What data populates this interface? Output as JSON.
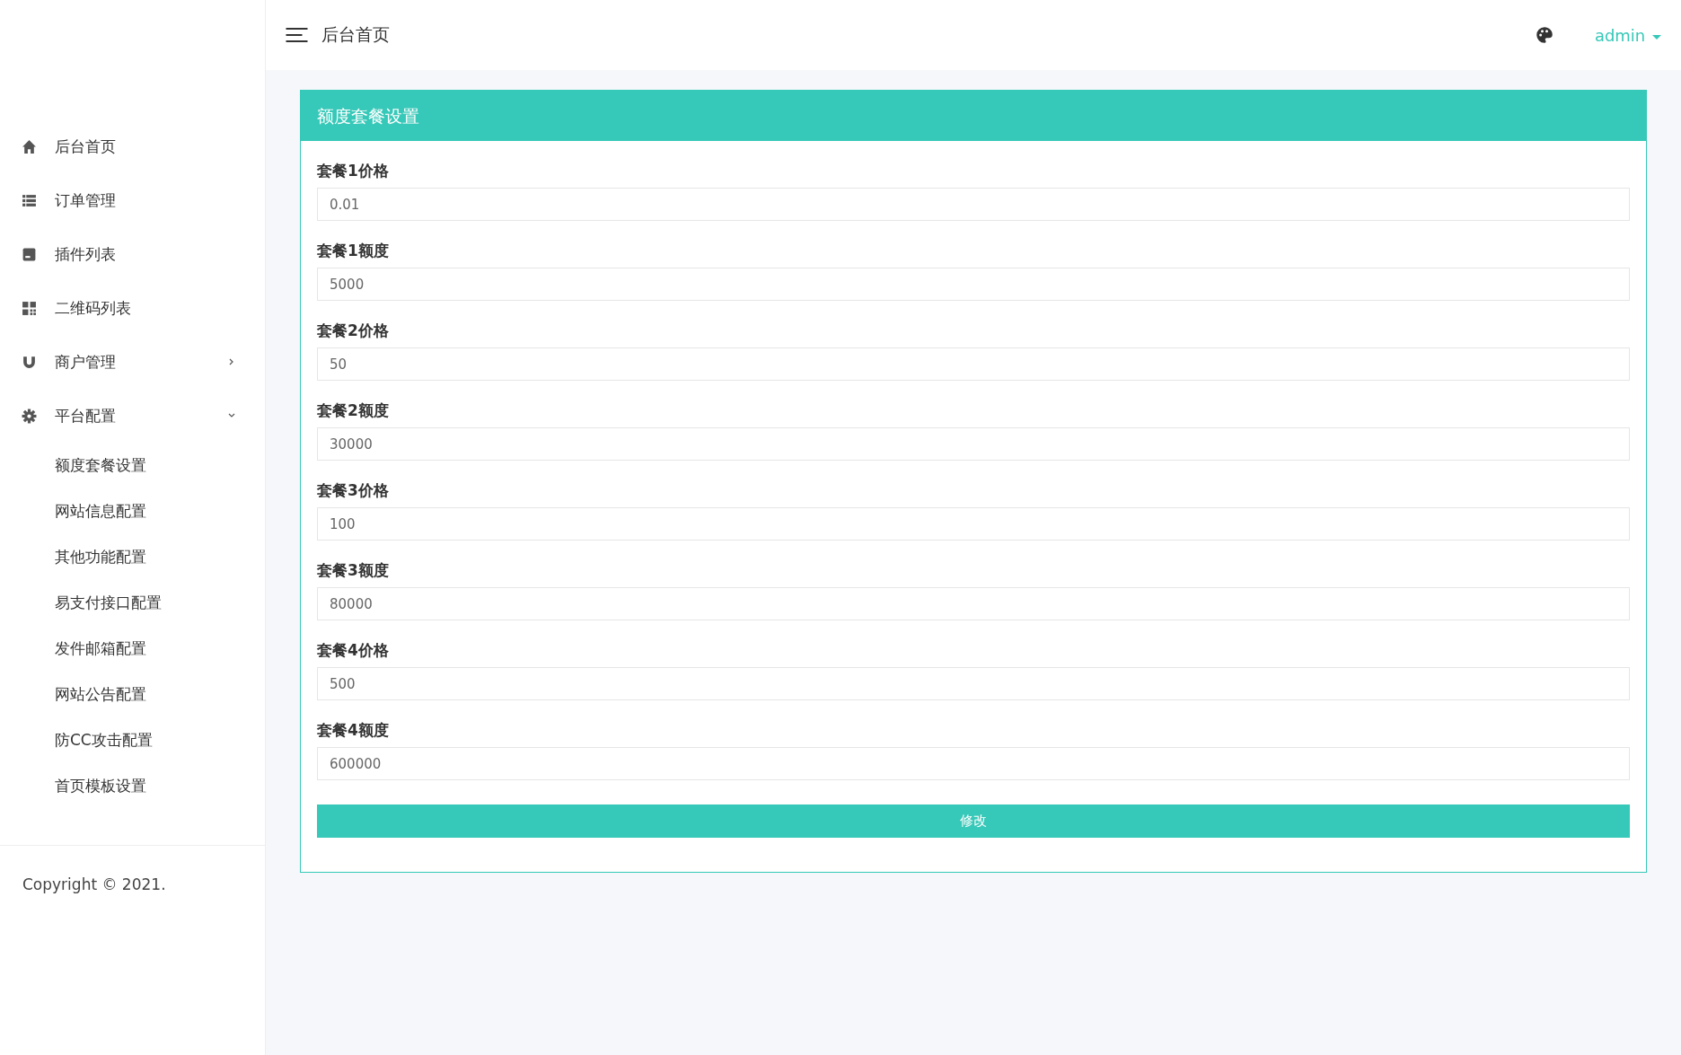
{
  "header": {
    "title": "后台首页",
    "user": "admin"
  },
  "sidebar": {
    "items": [
      {
        "label": "后台首页"
      },
      {
        "label": "订单管理"
      },
      {
        "label": "插件列表"
      },
      {
        "label": "二维码列表"
      },
      {
        "label": "商户管理",
        "expanded": false
      },
      {
        "label": "平台配置",
        "expanded": true,
        "children": [
          {
            "label": "额度套餐设置"
          },
          {
            "label": "网站信息配置"
          },
          {
            "label": "其他功能配置"
          },
          {
            "label": "易支付接口配置"
          },
          {
            "label": "发件邮箱配置"
          },
          {
            "label": "网站公告配置"
          },
          {
            "label": "防CC攻击配置"
          },
          {
            "label": "首页模板设置"
          }
        ]
      }
    ],
    "copyright": "Copyright © 2021."
  },
  "card": {
    "title": "额度套餐设置",
    "fields": [
      {
        "label": "套餐1价格",
        "value": "0.01"
      },
      {
        "label": "套餐1额度",
        "value": "5000"
      },
      {
        "label": "套餐2价格",
        "value": "50"
      },
      {
        "label": "套餐2额度",
        "value": "30000"
      },
      {
        "label": "套餐3价格",
        "value": "100"
      },
      {
        "label": "套餐3额度",
        "value": "80000"
      },
      {
        "label": "套餐4价格",
        "value": "500"
      },
      {
        "label": "套餐4额度",
        "value": "600000"
      }
    ],
    "submit": "修改"
  }
}
